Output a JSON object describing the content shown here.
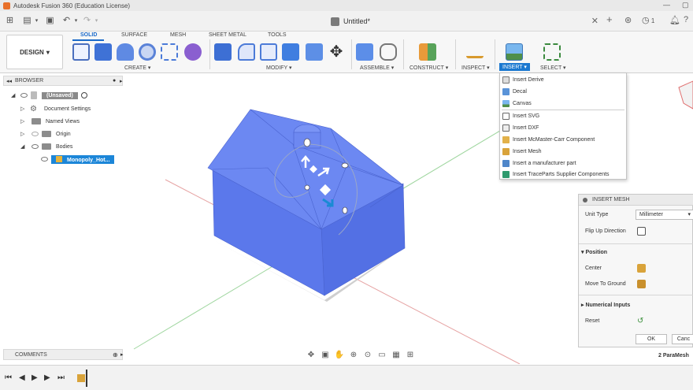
{
  "app": {
    "title": "Autodesk Fusion 360 (Education License)",
    "document_title": "Untitled*",
    "notification_count": "1"
  },
  "workspace": {
    "label": "DESIGN"
  },
  "ribbon": {
    "tabs": [
      "SOLID",
      "SURFACE",
      "MESH",
      "SHEET METAL",
      "TOOLS"
    ],
    "active_tab": "SOLID",
    "groups": {
      "create": "CREATE",
      "modify": "MODIFY",
      "assemble": "ASSEMBLE",
      "construct": "CONSTRUCT",
      "inspect": "INSPECT",
      "insert": "INSERT",
      "select": "SELECT"
    }
  },
  "browser": {
    "title": "BROWSER",
    "items": [
      {
        "label": "(Unsaved)"
      },
      {
        "label": "Document Settings"
      },
      {
        "label": "Named Views"
      },
      {
        "label": "Origin"
      },
      {
        "label": "Bodies"
      },
      {
        "label": "Monopoly_Hot..."
      }
    ]
  },
  "insert_menu": {
    "items": [
      {
        "label": "Insert Derive",
        "icon": "derive-icon"
      },
      {
        "label": "Decal",
        "icon": "decal-icon"
      },
      {
        "label": "Canvas",
        "icon": "canvas-icon"
      },
      {
        "label": "Insert SVG",
        "icon": "svg-icon"
      },
      {
        "label": "Insert DXF",
        "icon": "dxf-icon"
      },
      {
        "label": "Insert McMaster-Carr Component",
        "icon": "mcmaster-icon"
      },
      {
        "label": "Insert Mesh",
        "icon": "mesh-icon"
      },
      {
        "label": "Insert a manufacturer part",
        "icon": "manufacturer-part-icon"
      },
      {
        "label": "Insert TraceParts Supplier Components",
        "icon": "traceparts-icon"
      }
    ]
  },
  "insert_mesh_panel": {
    "title": "INSERT MESH",
    "unit_type_label": "Unit Type",
    "unit_type_value": "Millimeter",
    "flip_up_label": "Flip Up Direction",
    "position_section": "Position",
    "center_label": "Center",
    "move_to_ground_label": "Move To Ground",
    "numerical_inputs_section": "Numerical Inputs",
    "reset_label": "Reset",
    "ok_label": "OK",
    "cancel_label": "Canc"
  },
  "comments": {
    "title": "COMMENTS"
  },
  "status": {
    "selection": "2 ParaMesh"
  },
  "colors": {
    "accent": "#1b6ac9",
    "model": "#5b76e8",
    "selection": "#1c86d8"
  }
}
